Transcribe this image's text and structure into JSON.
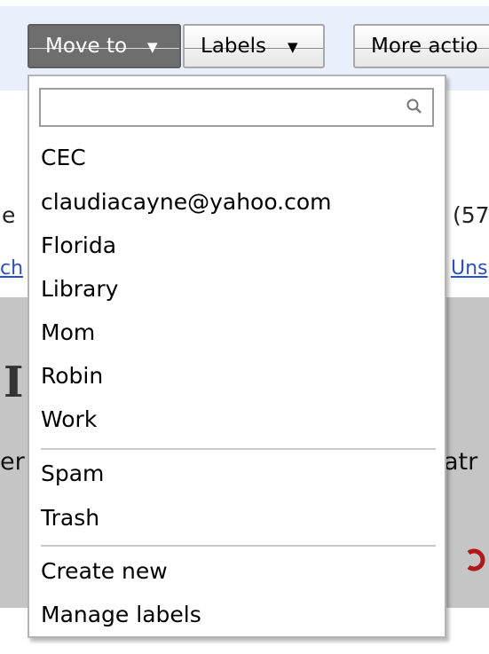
{
  "toolbar": {
    "move_to": "Move to",
    "labels": "Labels",
    "more_actions": "More actio",
    "arrow": "▼"
  },
  "background": {
    "row_fragment_left": "e",
    "row_fragment_right": "(57",
    "link_fragment_left": "ch",
    "link_fragment_right": "Uns",
    "panel_fragment_left": "er",
    "panel_fragment_right": "atr",
    "letter_fragment": "I"
  },
  "menu": {
    "search": {
      "value": "",
      "placeholder": ""
    },
    "labels": [
      "CEC",
      "claudiacayne@yahoo.com",
      "Florida",
      "Library",
      "Mom",
      "Robin",
      "Work"
    ],
    "system": [
      "Spam",
      "Trash"
    ],
    "actions": [
      "Create new",
      "Manage labels"
    ]
  }
}
